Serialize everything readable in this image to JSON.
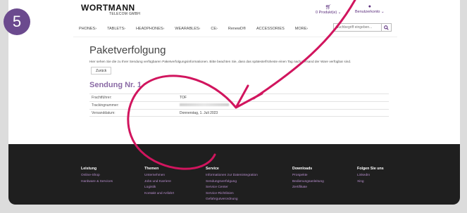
{
  "step_badge": "5",
  "header": {
    "logo_main": "WORTMANN",
    "logo_sub": "TELECOM GMBH",
    "cart_label": "0 Produkt(e) ⌄",
    "account_label": "Benutzerkonto ⌄"
  },
  "nav": {
    "items": [
      "PHONES›",
      "TABLETS›",
      "HEADPHONES›",
      "WEARABLES›",
      "CE›",
      "RenewD®",
      "ACCESSORIES",
      "MORE›"
    ],
    "search_placeholder": "Suchbegriff eingeben..."
  },
  "content": {
    "title": "Paketverfolgung",
    "intro": "Hier sehen Sie die zu Ihrer Sendung verfügbaren Paketverfolgungsinformationen. Bitte beachten Sie, dass das späteste/früheste einen Tag nach Versand der Ware verfügbar sind.",
    "back_label": "Zurück",
    "section_title": "Sendung Nr. 1",
    "rows": [
      {
        "key": "Frachtführer:",
        "value": "TOF"
      },
      {
        "key": "Trackingnummer:",
        "value": ""
      },
      {
        "key": "Versanddatum:",
        "value": "Donnerstag, 1. Juli 2023"
      }
    ]
  },
  "footer": {
    "columns": [
      {
        "heading": "Leistung",
        "links": [
          "Online-Shop",
          "Hardware & Services"
        ]
      },
      {
        "heading": "Themen",
        "links": [
          "Unternehmen",
          "Jobs und Karriere",
          "Logistik",
          "Kontakt und Anfahrt"
        ]
      },
      {
        "heading": "Service",
        "links": [
          "Informationen zur Datenintegration",
          "Sendungsverfolgung",
          "Service Center",
          "Service-Richtlinien",
          "Gefahrgutverordnung"
        ]
      },
      {
        "heading": "Downloads",
        "links": [
          "Prospekte",
          "Bedienungsanleitung",
          "Zertifikate"
        ]
      },
      {
        "heading": "Folgen Sie uns",
        "links": [
          "LinkedIn",
          "Xing"
        ]
      }
    ]
  },
  "colors": {
    "accent": "#5a2d7c",
    "annotation": "#d1155e",
    "badge": "#6b4a8e",
    "footer_bg": "#1f1f1f"
  },
  "icons": {
    "cart": "shopping-basket-icon",
    "account": "user-icon",
    "search": "search-icon"
  }
}
